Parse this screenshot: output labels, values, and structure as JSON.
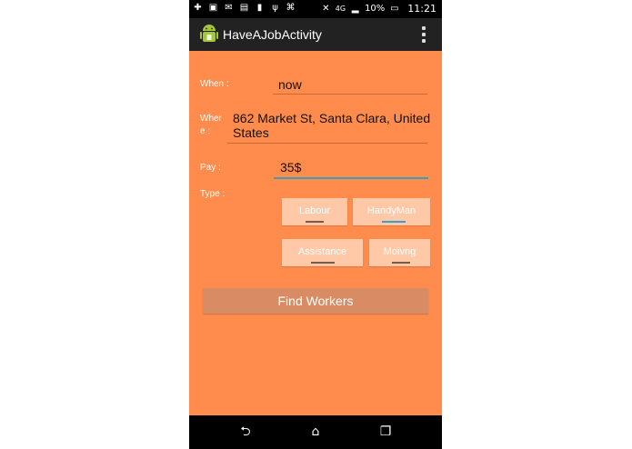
{
  "status": {
    "network": "4G",
    "battery": "10%",
    "time": "11:21"
  },
  "app": {
    "title": "HaveAJobActivity"
  },
  "form": {
    "when_label": "When :",
    "when_value": "now",
    "where_label_line1": "Wher",
    "where_label_line2": "e :",
    "where_value_line1": "862 Market St, Santa Clara, United",
    "where_value_line2": "States",
    "pay_label": "Pay :",
    "pay_value": "35$",
    "type_label": "Type :"
  },
  "types": [
    {
      "label": "Labour",
      "selected": false
    },
    {
      "label": "HandyMan",
      "selected": true
    },
    {
      "label": "Assistance",
      "selected": false
    },
    {
      "label": "Moivng",
      "selected": false
    }
  ],
  "actions": {
    "find_label": "Find Workers"
  },
  "colors": {
    "background": "#ff8c4c",
    "appbar": "#222222",
    "accent": "#3aa0d0"
  }
}
